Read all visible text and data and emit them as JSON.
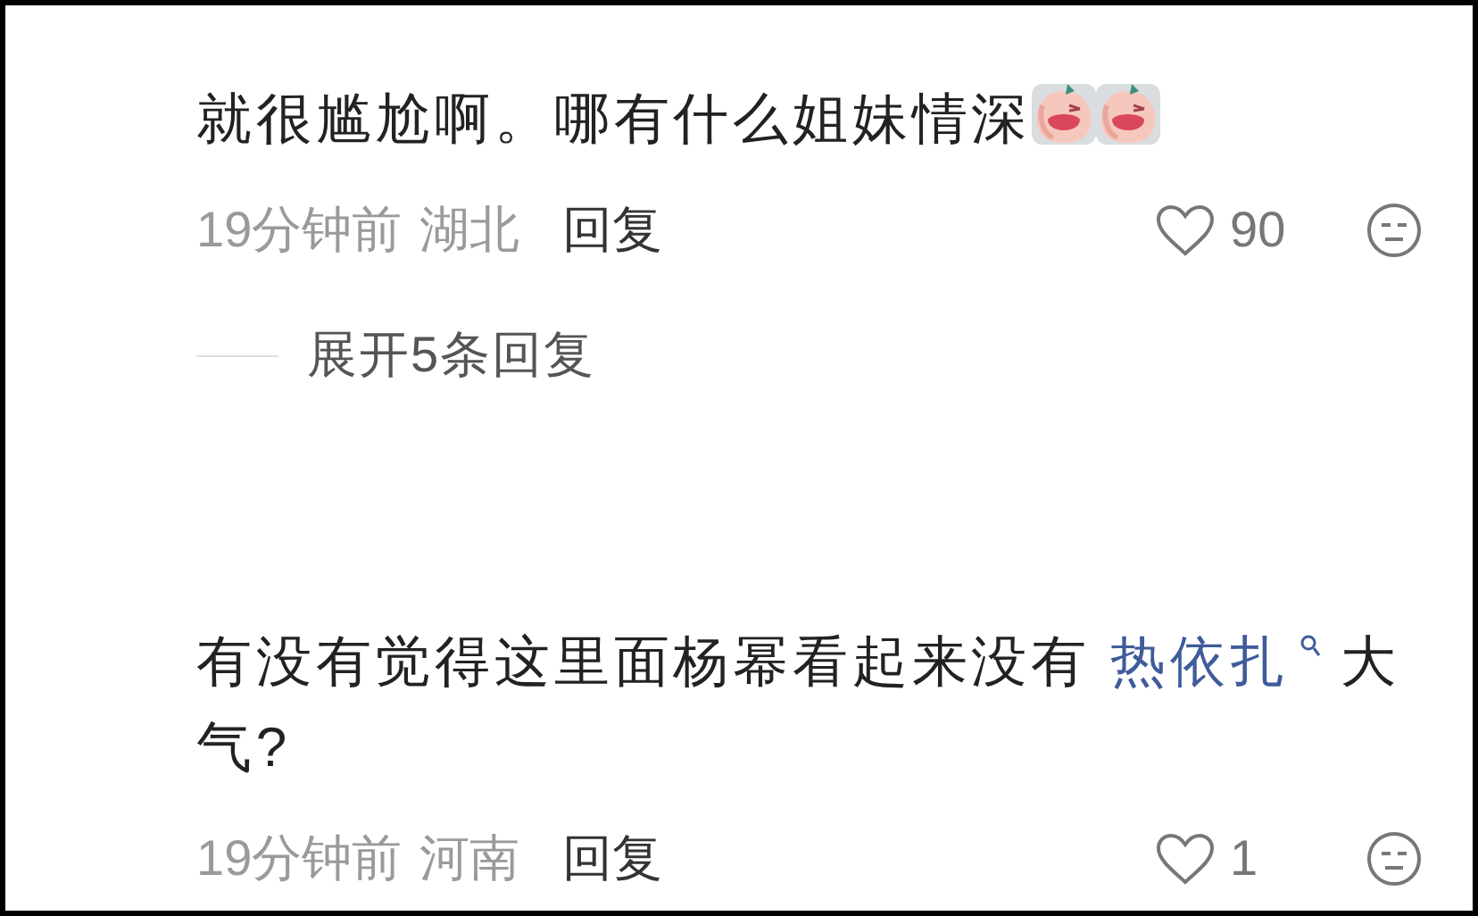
{
  "comments": [
    {
      "segments": [
        {
          "kind": "text",
          "text": "就很尴尬啊。哪有什么姐妹情深"
        }
      ],
      "emojis": [
        {
          "kind": "crying-peach"
        },
        {
          "kind": "crying-peach"
        }
      ],
      "time": "19分钟前",
      "location": "湖北",
      "reply": "回复",
      "likes": "90",
      "expand": "展开5条回复"
    },
    {
      "segments": [
        {
          "kind": "text",
          "text": "有没有觉得这里面杨幂看起来没有 "
        },
        {
          "kind": "link",
          "text": "热依扎"
        },
        {
          "kind": "text",
          "text": " 大气?"
        }
      ],
      "time": "19分钟前",
      "location": "河南",
      "reply": "回复",
      "likes": "1"
    }
  ]
}
